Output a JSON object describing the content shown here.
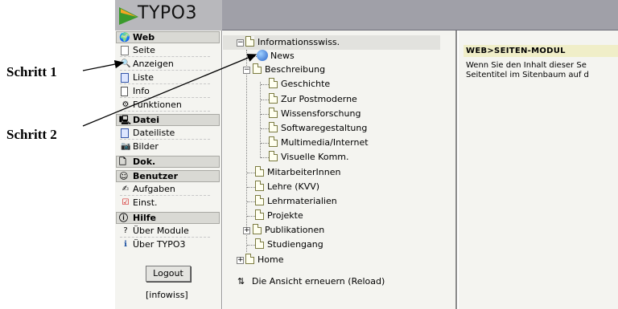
{
  "annotations": {
    "step1": "Schritt 1",
    "step2": "Schritt 2"
  },
  "app": {
    "logo_text": "TYPO3"
  },
  "menu": {
    "groups": [
      {
        "label": "Web",
        "icon": "globe-icon",
        "items": [
          {
            "label": "Seite",
            "icon": "page-icon"
          },
          {
            "label": "Anzeigen",
            "icon": "magnifier-icon"
          },
          {
            "label": "Liste",
            "icon": "list-icon"
          },
          {
            "label": "Info",
            "icon": "info-icon"
          },
          {
            "label": "Funktionen",
            "icon": "functions-icon"
          }
        ]
      },
      {
        "label": "Datei",
        "icon": "computer-icon",
        "items": [
          {
            "label": "Dateiliste",
            "icon": "filelist-icon"
          },
          {
            "label": "Bilder",
            "icon": "camera-icon"
          }
        ]
      },
      {
        "label": "Dok.",
        "icon": "document-icon",
        "items": []
      },
      {
        "label": "Benutzer",
        "icon": "user-icon",
        "items": [
          {
            "label": "Aufgaben",
            "icon": "tasks-icon"
          },
          {
            "label": "Einst.",
            "icon": "settings-icon"
          }
        ]
      },
      {
        "label": "Hilfe",
        "icon": "help-icon",
        "items": [
          {
            "label": "Über Module",
            "icon": "help-icon"
          },
          {
            "label": "Über TYPO3",
            "icon": "info-circle-icon"
          }
        ]
      }
    ],
    "logout_label": "Logout",
    "username": "[infowiss]"
  },
  "tree": {
    "nodes": [
      {
        "label": "Informationsswiss.",
        "level": 0,
        "expanded": true,
        "selected": true
      },
      {
        "label": "News",
        "level": 1,
        "icon": "globe-page-icon"
      },
      {
        "label": "Beschreibung",
        "level": 1,
        "expanded": true
      },
      {
        "label": "Geschichte",
        "level": 2
      },
      {
        "label": "Zur Postmoderne",
        "level": 2
      },
      {
        "label": "Wissensforschung",
        "level": 2
      },
      {
        "label": "Softwaregestaltung",
        "level": 2
      },
      {
        "label": "Multimedia/Internet",
        "level": 2
      },
      {
        "label": "Visuelle Komm.",
        "level": 2
      },
      {
        "label": "MitarbeiterInnen",
        "level": 1
      },
      {
        "label": "Lehre (KVV)",
        "level": 1
      },
      {
        "label": "Lehrmaterialien",
        "level": 1
      },
      {
        "label": "Projekte",
        "level": 1
      },
      {
        "label": "Publikationen",
        "level": 1,
        "collapsed": true
      },
      {
        "label": "Studiengang",
        "level": 1
      },
      {
        "label": "Home",
        "level": 0,
        "collapsed": true
      }
    ],
    "reload_label": "Die Ansicht erneuern (Reload)"
  },
  "content": {
    "title": "WEB>SEITEN-MODUL",
    "line1": "Wenn Sie den Inhalt dieser Se",
    "line2": "Seitentitel im Sitenbaum auf d"
  }
}
